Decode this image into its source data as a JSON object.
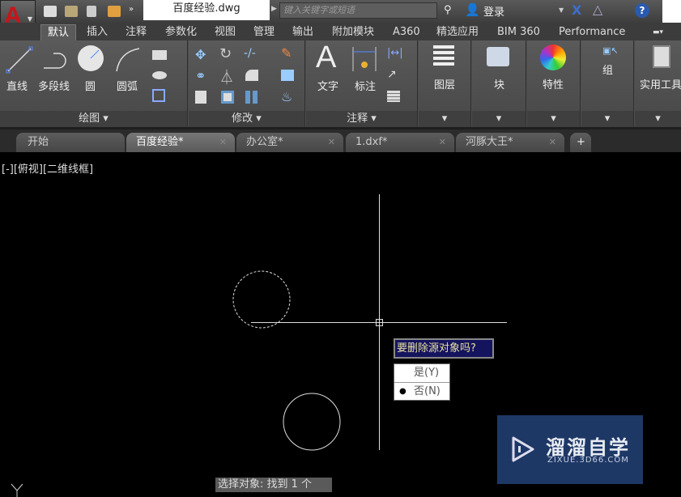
{
  "app": {
    "logo": "A",
    "document_title": "百度经验.dwg",
    "search_placeholder": "键入关键字或短语",
    "login_label": "登录",
    "icons": [
      "new-icon",
      "open-icon",
      "save-icon",
      "saveas-icon",
      "more-icon",
      "binoculars-icon",
      "user-icon",
      "exchange-icon",
      "a360-icon",
      "help-icon"
    ]
  },
  "ribbon_tabs": [
    "默认",
    "插入",
    "注释",
    "参数化",
    "视图",
    "管理",
    "输出",
    "附加模块",
    "A360",
    "精选应用",
    "BIM 360",
    "Performance"
  ],
  "panels": {
    "draw": {
      "title": "绘图",
      "buttons": [
        "直线",
        "多段线",
        "圆",
        "圆弧"
      ]
    },
    "modify": {
      "title": "修改"
    },
    "annotate": {
      "title": "注释",
      "buttons": [
        "文字",
        "标注"
      ]
    },
    "layers": {
      "label": "图层"
    },
    "block": {
      "label": "块"
    },
    "properties": {
      "label": "特性"
    },
    "group": {
      "label": "组"
    },
    "utilities": {
      "label": "实用工具"
    }
  },
  "file_tabs": [
    {
      "label": "开始"
    },
    {
      "label": "百度经验*",
      "active": true
    },
    {
      "label": "办公室*"
    },
    {
      "label": "1.dxf*"
    },
    {
      "label": "河豚大王*"
    }
  ],
  "viewport_label": "[-][俯视][二维线框]",
  "prompt": {
    "question": "要删除源对象吗?",
    "options": [
      "是(Y)",
      "否(N)"
    ],
    "selected": "否(N)"
  },
  "status_text": "选择对象: 找到 1 个",
  "watermark": {
    "title": "溜溜自学",
    "url": "ZIXUE.3D66.COM"
  },
  "colors": {
    "prompt_bg": "#14145e",
    "watermark_bg": "#1e3866",
    "logo": "#c4161c"
  }
}
